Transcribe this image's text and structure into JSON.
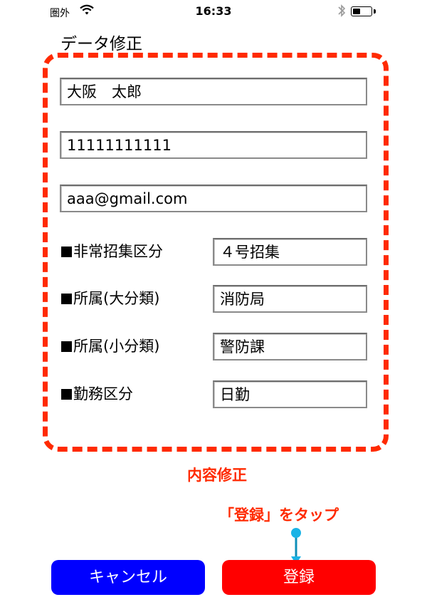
{
  "status_bar": {
    "carrier": "圏外",
    "time": "16:33",
    "battery_percent": 45
  },
  "title": "データ修正",
  "fields": {
    "name": "大阪　太郎",
    "phone": "11111111111",
    "email": "aaa@gmail.com"
  },
  "rows": [
    {
      "label": "非常招集区分",
      "value": "４号招集"
    },
    {
      "label": "所属(大分類)",
      "value": "消防局"
    },
    {
      "label": "所属(小分類)",
      "value": "警防課"
    },
    {
      "label": "勤務区分",
      "value": "日勤"
    }
  ],
  "annotation": {
    "edit_caption": "内容修正",
    "tap_note": "「登録」をタップ"
  },
  "buttons": {
    "cancel": "キャンセル",
    "register": "登録"
  },
  "colors": {
    "accent_red": "#ff2a00",
    "cancel_blue": "#0000ff",
    "register_red": "#ff0000",
    "pointer_cyan": "#1ab3e6"
  }
}
